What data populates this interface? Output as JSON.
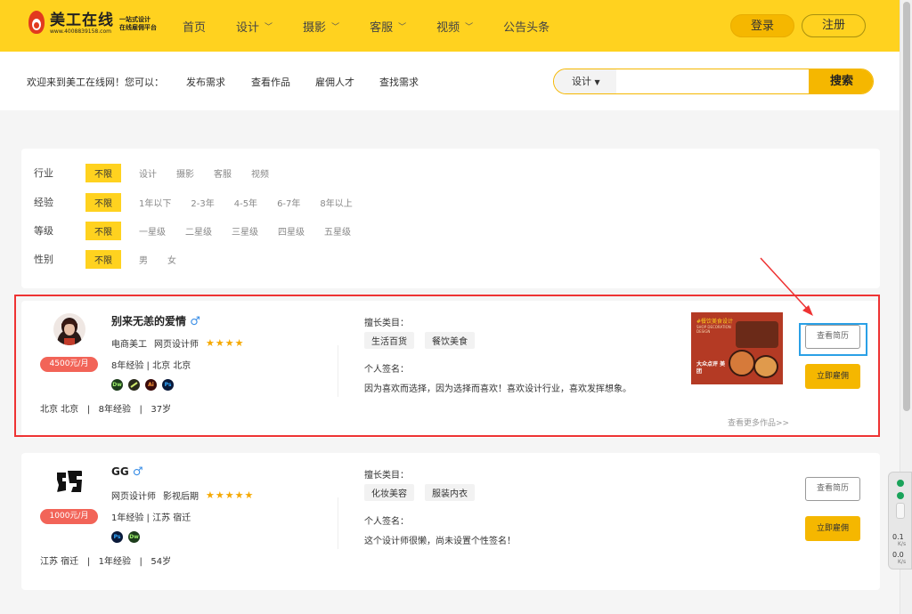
{
  "header": {
    "logo": {
      "name": "美工在线",
      "phone": "www.4008839158.com",
      "slogan_line1": "一站式设计",
      "slogan_line2": "在线雇佣平台"
    },
    "nav": [
      {
        "label": "首页",
        "has_dropdown": false
      },
      {
        "label": "设计",
        "has_dropdown": true
      },
      {
        "label": "摄影",
        "has_dropdown": true
      },
      {
        "label": "客服",
        "has_dropdown": true
      },
      {
        "label": "视频",
        "has_dropdown": true
      },
      {
        "label": "公告头条",
        "has_dropdown": false
      }
    ],
    "login_label": "登录",
    "register_label": "注册"
  },
  "subbar": {
    "welcome": "欢迎来到美工在线网！您可以：",
    "links": [
      "发布需求",
      "查看作品",
      "雇佣人才",
      "查找需求"
    ],
    "search": {
      "category": "设计",
      "value": "",
      "placeholder": "",
      "button_label": "搜索"
    }
  },
  "filters": [
    {
      "label": "行业",
      "options": [
        "不限",
        "设计",
        "摄影",
        "客服",
        "视频"
      ],
      "selected": "不限"
    },
    {
      "label": "经验",
      "options": [
        "不限",
        "1年以下",
        "2-3年",
        "4-5年",
        "6-7年",
        "8年以上"
      ],
      "selected": "不限"
    },
    {
      "label": "等级",
      "options": [
        "不限",
        "一星级",
        "二星级",
        "三星级",
        "四星级",
        "五星级"
      ],
      "selected": "不限"
    },
    {
      "label": "性别",
      "options": [
        "不限",
        "男",
        "女"
      ],
      "selected": "不限"
    }
  ],
  "designers": [
    {
      "name": "别来无恙的爱情",
      "gender_symbol": "♂",
      "salary": "4500元/月",
      "roles": [
        "电商美工",
        "网页设计师"
      ],
      "stars": "★★★★",
      "rating": 4,
      "experience_line": "8年经验  |  北京 北京",
      "skills": [
        "Dw",
        "",
        "Ai",
        "Ps"
      ],
      "bottom_info": "北京 北京   |   8年经验   |   37岁",
      "specialty_title": "擅长类目：",
      "specialties": [
        "生活百货",
        "餐饮美食"
      ],
      "signature_title": "个人签名：",
      "signature": "因为喜欢而选择，因为选择而喜欢！喜欢设计行业，喜欢发挥想象。",
      "more_works": "查看更多作品>>",
      "thumbnail": {
        "line1": "#餐饮美食设计",
        "line2": "SHOP DECORATION DESIGN",
        "line3": "大众点评 美团"
      },
      "view_resume_label": "查看简历",
      "hire_label": "立即雇佣"
    },
    {
      "name": "GG",
      "gender_symbol": "♂",
      "salary": "1000元/月",
      "roles": [
        "网页设计师",
        "影视后期"
      ],
      "stars": "★★★★★",
      "rating": 5,
      "experience_line": "1年经验  |  江苏 宿迁",
      "skills": [
        "Ps",
        "Dw"
      ],
      "bottom_info": "江苏 宿迁   |   1年经验   |   54岁",
      "specialty_title": "擅长类目：",
      "specialties": [
        "化妆美容",
        "服装内衣"
      ],
      "signature_title": "个人签名：",
      "signature": "这个设计师很懒，尚未设置个性签名！",
      "view_resume_label": "查看简历",
      "hire_label": "立即雇佣"
    }
  ],
  "side_widget": {
    "up_value": "0.1",
    "up_unit": "K/s",
    "down_value": "0.0",
    "down_unit": "K/s"
  },
  "colors": {
    "brand_yellow": "#ffd21f",
    "accent_orange": "#f5b700",
    "salary_red": "#f26458",
    "annotation_red": "#e33333",
    "annotation_blue": "#2aa0e6"
  },
  "icons": [
    "logo-flame-icon",
    "chevron-down-icon",
    "male-icon",
    "star-icon",
    "arrow-annotation-icon"
  ]
}
